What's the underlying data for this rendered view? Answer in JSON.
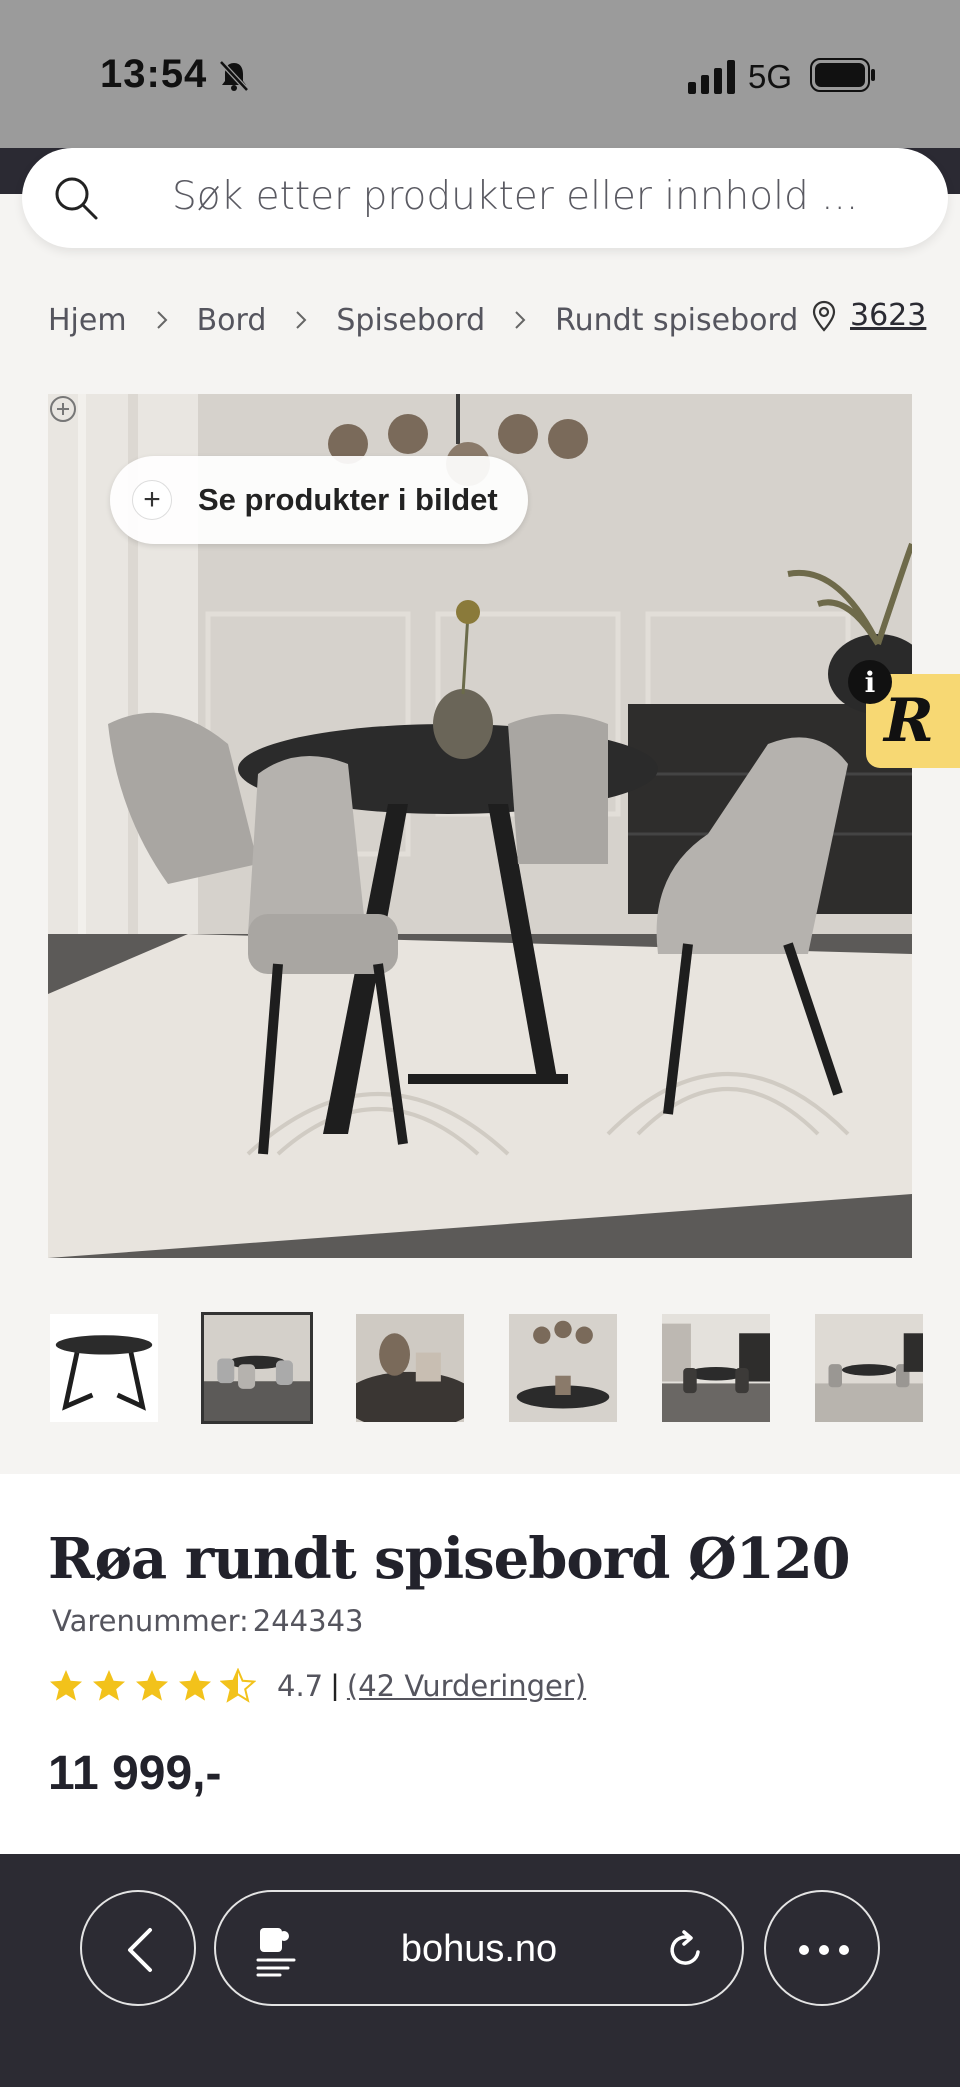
{
  "status_bar": {
    "time": "13:54",
    "network": "5G"
  },
  "search": {
    "placeholder": "Søk etter produkter eller innhold ..."
  },
  "breadcrumb": {
    "items": [
      "Hjem",
      "Bord",
      "Spisebord",
      "Rundt spisebord"
    ]
  },
  "location": {
    "code": "3623"
  },
  "hero": {
    "see_products_label": "Se produkter i bildet"
  },
  "reviews_badge": {
    "info": "i",
    "letter": "R"
  },
  "product": {
    "title": "Røa rundt spisebord Ø120",
    "sku_label": "Varenummer:",
    "sku": "244343",
    "rating_value": "4.7",
    "rating_separator": "|",
    "rating_count": "(42 Vurderinger)",
    "rating_stars": 4.5,
    "price": "11 999,-"
  },
  "browser": {
    "url": "bohus.no"
  },
  "colors": {
    "header_dark": "#2b2a33",
    "badge_yellow": "#f7d873",
    "star": "#f2c21b"
  }
}
